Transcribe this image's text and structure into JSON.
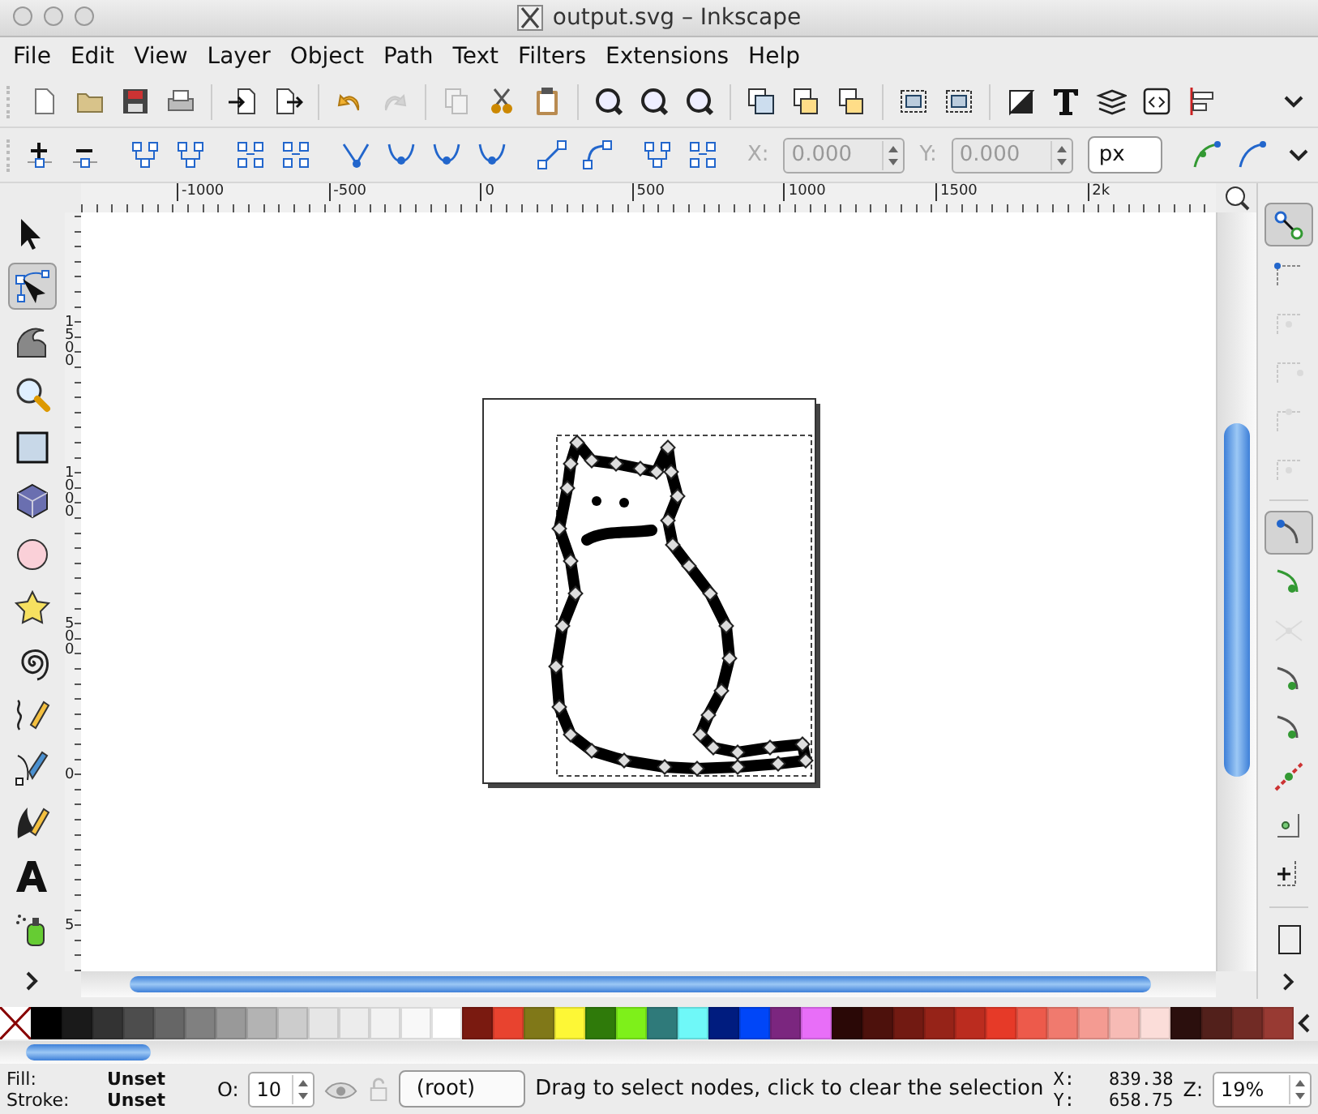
{
  "window": {
    "title": "output.svg – Inkscape"
  },
  "menu": [
    "File",
    "Edit",
    "View",
    "Layer",
    "Object",
    "Path",
    "Text",
    "Filters",
    "Extensions",
    "Help"
  ],
  "toolbar": {
    "undo_disabled": false,
    "redo_disabled": true
  },
  "node_toolbar": {
    "x_label": "X:",
    "x_value": "0.000",
    "y_label": "Y:",
    "y_value": "0.000",
    "fields_disabled": true,
    "unit": "px"
  },
  "ruler_h": [
    "-1000",
    "-500",
    "0",
    "500",
    "1000",
    "1500",
    "2k"
  ],
  "ruler_v": [
    "1500",
    "1000",
    "500",
    "0",
    "5"
  ],
  "tools": [
    {
      "selected": false
    },
    {
      "selected": true
    },
    {
      "selected": false
    },
    {
      "selected": false
    },
    {
      "selected": false
    },
    {
      "selected": false
    },
    {
      "selected": false
    },
    {
      "selected": false
    },
    {
      "selected": false
    },
    {
      "selected": false
    },
    {
      "selected": false
    },
    {
      "selected": false
    },
    {
      "selected": false
    },
    {
      "selected": false
    }
  ],
  "snap": [
    {
      "selected": true,
      "disabled": false
    },
    {
      "selected": false,
      "disabled": false
    },
    {
      "selected": false,
      "disabled": true
    },
    {
      "selected": false,
      "disabled": true
    },
    {
      "selected": false,
      "disabled": true
    },
    {
      "selected": false,
      "disabled": true
    },
    {
      "selected": true,
      "disabled": false
    },
    {
      "selected": false,
      "disabled": false
    },
    {
      "selected": false,
      "disabled": true
    },
    {
      "selected": false,
      "disabled": false
    },
    {
      "selected": false,
      "disabled": false
    },
    {
      "selected": false,
      "disabled": false
    },
    {
      "selected": false,
      "disabled": false
    },
    {
      "selected": false,
      "disabled": false
    },
    {
      "selected": false,
      "disabled": false
    }
  ],
  "palette": [
    {
      "color": "#000000"
    },
    {
      "color": "#1a1a1a"
    },
    {
      "color": "#333333"
    },
    {
      "color": "#4d4d4d"
    },
    {
      "color": "#666666"
    },
    {
      "color": "#808080"
    },
    {
      "color": "#999999"
    },
    {
      "color": "#b3b3b3"
    },
    {
      "color": "#cccccc"
    },
    {
      "color": "#e6e6e6"
    },
    {
      "color": "#ececec"
    },
    {
      "color": "#f2f2f2"
    },
    {
      "color": "#f8f8f8"
    },
    {
      "color": "#ffffff"
    },
    {
      "color": "#7a1a10"
    },
    {
      "color": "#e8432f"
    },
    {
      "color": "#807818"
    },
    {
      "color": "#fdf736"
    },
    {
      "color": "#2f7a0a"
    },
    {
      "color": "#7ef01a"
    },
    {
      "color": "#2f7a7a"
    },
    {
      "color": "#6ff8f8"
    },
    {
      "color": "#001c7f"
    },
    {
      "color": "#0046f8"
    },
    {
      "color": "#7b267f"
    },
    {
      "color": "#e86ef8"
    },
    {
      "color": "#2a0806"
    },
    {
      "color": "#4d110c"
    },
    {
      "color": "#721a12"
    },
    {
      "color": "#962318"
    },
    {
      "color": "#bb2c1f"
    },
    {
      "color": "#e63a28"
    },
    {
      "color": "#ed5a4b"
    },
    {
      "color": "#f07a6e"
    },
    {
      "color": "#f49b92"
    },
    {
      "color": "#f7bbb5"
    },
    {
      "color": "#fbddd9"
    },
    {
      "color": "#2b0f0d"
    },
    {
      "color": "#52201b"
    },
    {
      "color": "#712b25"
    },
    {
      "color": "#983a33"
    }
  ],
  "status": {
    "fill_label": "Fill:",
    "fill_value": "Unset",
    "stroke_label": "Stroke:",
    "stroke_value": "Unset",
    "opacity_label": "O:",
    "opacity_value": "10",
    "layer": "(root)",
    "message": "Drag to select nodes, click to clear the selection",
    "x_label": "X:",
    "x_value": "839.38",
    "y_label": "Y:",
    "y_value": "658.75",
    "zoom_label": "Z:",
    "zoom_value": "19%"
  }
}
